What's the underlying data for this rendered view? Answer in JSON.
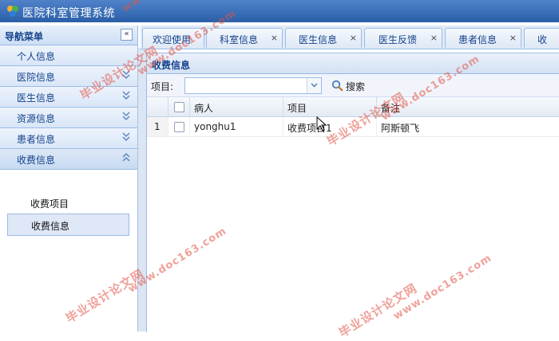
{
  "app": {
    "title": "医院科室管理系统"
  },
  "sidebar": {
    "title": "导航菜单",
    "collapse": "«",
    "items": [
      {
        "label": "个人信息",
        "chevron": "«"
      },
      {
        "label": "医院信息",
        "chevron": "«"
      },
      {
        "label": "医生信息",
        "chevron": "«"
      },
      {
        "label": "资源信息",
        "chevron": "«"
      },
      {
        "label": "患者信息",
        "chevron": "«"
      },
      {
        "label": "收费信息",
        "chevron": "«"
      }
    ],
    "subitems": [
      {
        "label": "收费项目"
      },
      {
        "label": "收费信息",
        "selected": true
      }
    ]
  },
  "tabs": [
    {
      "label": "欢迎使用",
      "close": ""
    },
    {
      "label": "科室信息",
      "close": "×"
    },
    {
      "label": "医生信息",
      "close": "×"
    },
    {
      "label": "医生反馈",
      "close": "×"
    },
    {
      "label": "患者信息",
      "close": "×"
    },
    {
      "label": "收",
      "close": ""
    }
  ],
  "panel": {
    "title": "收费信息"
  },
  "toolbar": {
    "field_label": "项目:",
    "field_value": "",
    "search_label": "搜索"
  },
  "grid": {
    "columns": [
      "病人",
      "项目",
      "备注"
    ],
    "rows": [
      {
        "num": "1",
        "patient": "yonghu1",
        "item": "收费项目1",
        "note": "阿斯顿飞"
      }
    ]
  },
  "watermarks": [
    "毕业设计论文网",
    "www.doc163.com"
  ],
  "colors": {
    "titlebar": "#2a5fa8",
    "accent": "#15428b",
    "border": "#99bbe8",
    "watermark": "#e25446"
  }
}
